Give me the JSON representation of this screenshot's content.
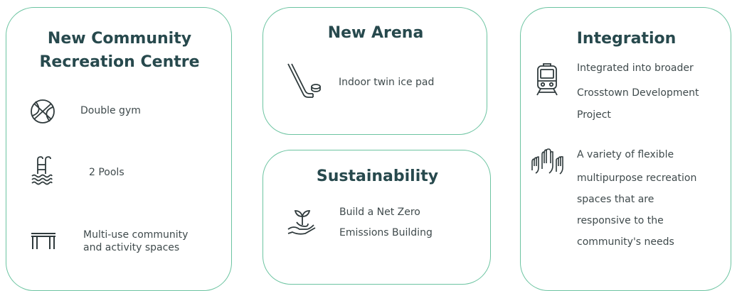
{
  "cards": {
    "centre": {
      "title_line1": "New Community",
      "title_line2": "Recreation Centre",
      "items": [
        {
          "icon": "basketball-icon",
          "text": "Double gym"
        },
        {
          "icon": "pool-ladder-icon",
          "text": "2 Pools"
        },
        {
          "icon": "table-icon",
          "text_line1": "Multi-use community",
          "text_line2": "and activity spaces"
        }
      ]
    },
    "arena": {
      "title": "New Arena",
      "items": [
        {
          "icon": "hockey-stick-puck-icon",
          "text": "Indoor twin ice pad"
        }
      ]
    },
    "sustainability": {
      "title": "Sustainability",
      "items": [
        {
          "icon": "hand-sprout-icon",
          "text_line1": "Build a Net Zero",
          "text_line2": "Emissions Building"
        }
      ]
    },
    "integration": {
      "title": "Integration",
      "items": [
        {
          "icon": "train-icon",
          "lines": [
            "Integrated into broader",
            "Crosstown Development",
            "Project"
          ]
        },
        {
          "icon": "raised-hands-icon",
          "lines": [
            "A variety of flexible",
            "multipurpose recreation",
            "spaces that are",
            "responsive to the",
            "community's needs"
          ]
        }
      ]
    }
  },
  "colors": {
    "card_border": "#6cc4a1",
    "title_text": "#27494d",
    "body_text": "#3f4a4c",
    "icon_stroke": "#2f3a3c"
  }
}
